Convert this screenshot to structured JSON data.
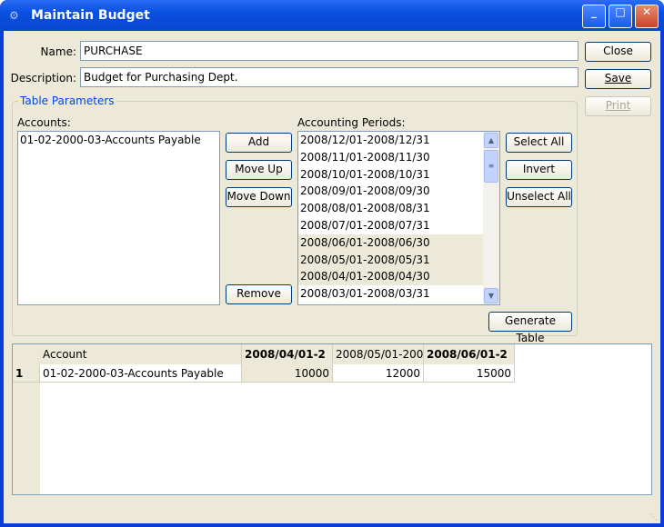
{
  "window": {
    "title": "Maintain Budget"
  },
  "form": {
    "name_label": "Name:",
    "name_value": "PURCHASE",
    "description_label": "Description:",
    "description_value": "Budget for Purchasing Dept."
  },
  "buttons": {
    "close": "Close",
    "save": "Save",
    "print": "Print",
    "add": "Add",
    "move_up": "Move Up",
    "move_down": "Move Down",
    "remove": "Remove",
    "select_all": "Select All",
    "invert": "Invert",
    "unselect_all": "Unselect All",
    "generate_table": "Generate Table"
  },
  "table_params": {
    "legend": "Table Parameters",
    "accounts_label": "Accounts:",
    "periods_label": "Accounting Periods:",
    "accounts": [
      "01-02-2000-03-Accounts Payable"
    ],
    "periods": [
      {
        "label": "2008/12/01-2008/12/31",
        "selected": false
      },
      {
        "label": "2008/11/01-2008/11/30",
        "selected": false
      },
      {
        "label": "2008/10/01-2008/10/31",
        "selected": false
      },
      {
        "label": "2008/09/01-2008/09/30",
        "selected": false
      },
      {
        "label": "2008/08/01-2008/08/31",
        "selected": false
      },
      {
        "label": "2008/07/01-2008/07/31",
        "selected": false
      },
      {
        "label": "2008/06/01-2008/06/30",
        "selected": true
      },
      {
        "label": "2008/05/01-2008/05/31",
        "selected": true
      },
      {
        "label": "2008/04/01-2008/04/30",
        "selected": true
      },
      {
        "label": "2008/03/01-2008/03/31",
        "selected": false
      }
    ]
  },
  "grid": {
    "headers": [
      "Account",
      "2008/04/01-2",
      "2008/05/01-200",
      "2008/06/01-2"
    ],
    "rows": [
      {
        "num": "1",
        "account": "01-02-2000-03-Accounts Payable",
        "values": [
          "10000",
          "12000",
          "15000"
        ]
      }
    ]
  }
}
